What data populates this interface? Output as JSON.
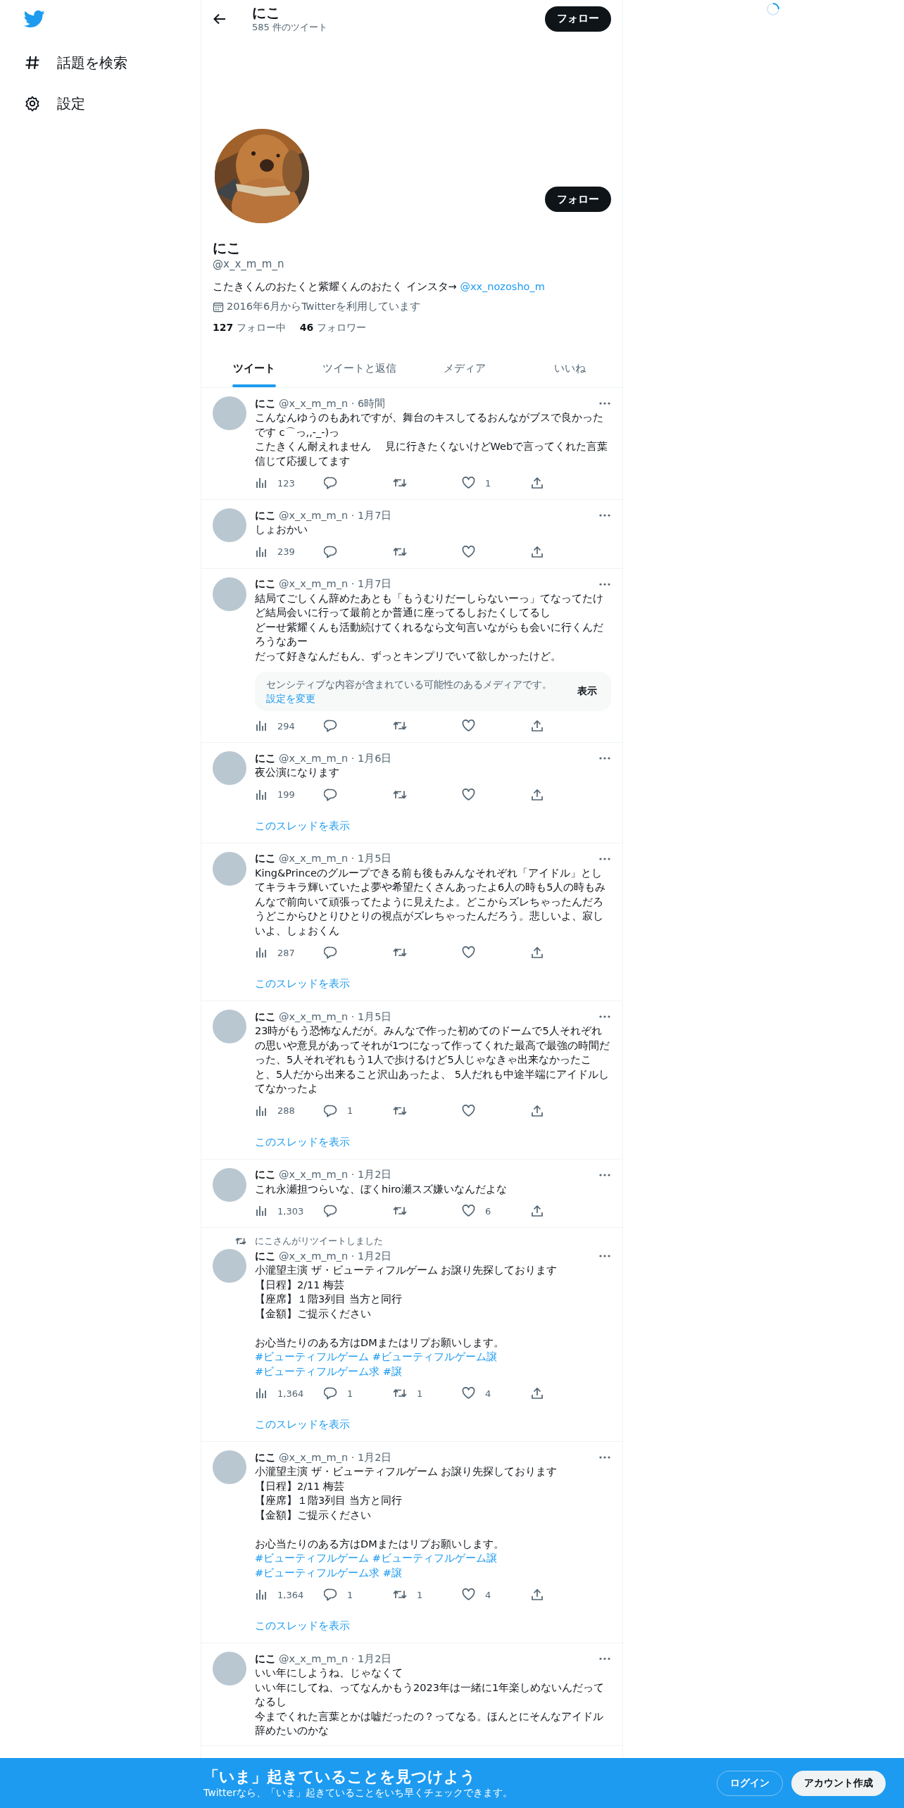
{
  "sidebar": {
    "items": [
      {
        "kind": "search",
        "label": "話題を検索"
      },
      {
        "kind": "settings",
        "label": "設定"
      }
    ]
  },
  "header": {
    "name": "にこ",
    "tweet_count": "585 件のツイート",
    "follow_button": "フォロー"
  },
  "profile": {
    "follow_button": "フォロー",
    "name": "にこ",
    "handle": "@x_x_m_m_n",
    "bio": "こたきくんのおたくと紫耀くんのおたく インスタ→",
    "bio_link": "@xx_nozosho_m",
    "joined": "2016年6月からTwitterを利用しています",
    "following_count": "127",
    "following_label": "フォロー中",
    "followers_count": "46",
    "followers_label": "フォロワー"
  },
  "tabs": [
    {
      "label": "ツイート",
      "selected": true
    },
    {
      "label": "ツイートと返信",
      "selected": false
    },
    {
      "label": "メディア",
      "selected": false
    },
    {
      "label": "いいね",
      "selected": false
    }
  ],
  "tweets": [
    {
      "author": "にこ",
      "meta": "@x_x_m_m_n · 6時間",
      "paragraphs": [
        [
          "こんなんゆうのもあれですが、舞台のキスしてるおんながブスで良かったです c⌒っ,,-_-)っ",
          "こたきくん耐えれません 　見に行きたくないけどWebで言ってくれた言葉信じて応援してます"
        ]
      ],
      "stats": {
        "views": "123",
        "likes": "1"
      }
    },
    {
      "author": "にこ",
      "meta": "@x_x_m_m_n · 1月7日",
      "paragraphs": [
        [
          "しょおかい"
        ]
      ],
      "stats": {
        "views": "239"
      }
    },
    {
      "author": "にこ",
      "meta": "@x_x_m_m_n · 1月7日",
      "paragraphs": [
        [
          "結局てごしくん辞めたあとも「もうむりだーしらないーっ」てなってたけど結局会いに行って最前とか普通に座ってるしおたくしてるし",
          "どーせ紫耀くんも活動続けてくれるなら文句言いながらも会いに行くんだろうなあー",
          "だって好きなんだもん、ずっとキンプリでいて欲しかったけど。"
        ]
      ],
      "sensitive": {
        "text": "センシティブな内容が含まれている可能性のあるメディアです。",
        "link": "設定を変更",
        "button": "表示"
      },
      "stats": {
        "views": "294"
      }
    },
    {
      "author": "にこ",
      "meta": "@x_x_m_m_n · 1月6日",
      "paragraphs": [
        [
          "夜公演になります"
        ]
      ],
      "stats": {
        "views": "199"
      },
      "thread_link": "このスレッドを表示"
    },
    {
      "author": "にこ",
      "meta": "@x_x_m_m_n · 1月5日",
      "paragraphs": [
        [
          "King&Princeのグループできる前も後もみんなそれぞれ「アイドル」としてキラキラ輝いていたよ夢や希望たくさんあったよ6人の時も5人の時もみんなで前向いて頑張ってたように見えたよ。どこからズレちゃったんだろうどこからひとりひとりの視点がズレちゃったんだろう。悲しいよ、寂しいよ、しょおくん"
        ]
      ],
      "stats": {
        "views": "287"
      },
      "thread_link": "このスレッドを表示"
    },
    {
      "author": "にこ",
      "meta": "@x_x_m_m_n · 1月5日",
      "paragraphs": [
        [
          "23時がもう恐怖なんだが。みんなで作った初めてのドームで5人それぞれの思いや意見があってそれが1つになって作ってくれた最高で最強の時間だった、5人それぞれもう1人で歩けるけど5人じゃなきゃ出来なかったこと、5人だから出来ること沢山あったよ、 5人だれも中途半端にアイドルしてなかったよ"
        ]
      ],
      "stats": {
        "views": "288",
        "replies": "1"
      },
      "thread_link": "このスレッドを表示"
    },
    {
      "author": "にこ",
      "meta": "@x_x_m_m_n · 1月2日",
      "paragraphs": [
        [
          "これ永瀬担つらいな、ぼくhiro瀬スズ嫌いなんだよな"
        ]
      ],
      "stats": {
        "views": "1,303",
        "likes": "6"
      }
    },
    {
      "retweeted_by": "にこさんがリツイートしました",
      "author": "にこ",
      "meta": "@x_x_m_m_n · 1月2日",
      "paragraphs": [
        [
          "小瀧望主演 ザ・ビューティフルゲーム お譲り先探しております",
          "【日程】2/11 梅芸",
          "【座席】１階3列目 当方と同行",
          "【金額】ご提示ください"
        ],
        [
          "お心当たりのある方はDMまたはリプお願いします。"
        ]
      ],
      "hashtags": [
        "#ビューティフルゲーム",
        "#ビューティフルゲーム譲",
        "#ビューティフルゲーム求",
        "#譲"
      ],
      "stats": {
        "views": "1,364",
        "replies": "1",
        "retweets": "1",
        "likes": "4"
      },
      "thread_link": "このスレッドを表示"
    },
    {
      "author": "にこ",
      "meta": "@x_x_m_m_n · 1月2日",
      "paragraphs": [
        [
          "小瀧望主演 ザ・ビューティフルゲーム お譲り先探しております",
          "【日程】2/11 梅芸",
          "【座席】１階3列目 当方と同行",
          "【金額】ご提示ください"
        ],
        [
          "お心当たりのある方はDMまたはリプお願いします。"
        ]
      ],
      "hashtags": [
        "#ビューティフルゲーム",
        "#ビューティフルゲーム譲",
        "#ビューティフルゲーム求",
        "#譲"
      ],
      "stats": {
        "views": "1,364",
        "replies": "1",
        "retweets": "1",
        "likes": "4"
      },
      "thread_link": "このスレッドを表示"
    },
    {
      "author": "にこ",
      "meta": "@x_x_m_m_n · 1月2日",
      "paragraphs": [
        [
          "いい年にしようね、じゃなくて",
          "いい年にしてね、ってなんかもう2023年は一緒に1年楽しめないんだってなるし",
          "今までくれた言葉とかは嘘だったの？ってなる。ほんとにそんなアイドル辞めたいのかな"
        ]
      ]
    }
  ],
  "banner": {
    "title": "「いま」起きていることを見つけよう",
    "subtitle": "Twitterなら、「いま」起きていることをいち早くチェックできます。",
    "login_button": "ログイン",
    "signup_button": "アカウント作成"
  }
}
